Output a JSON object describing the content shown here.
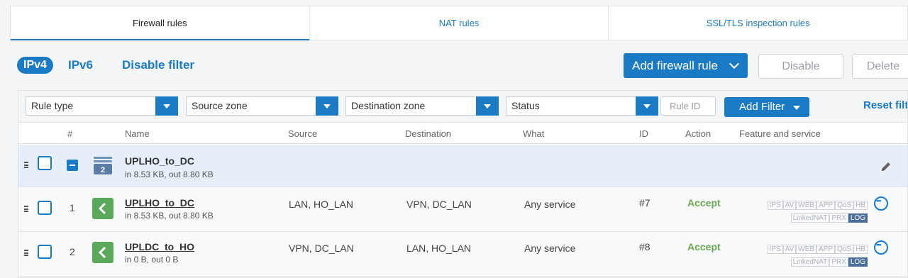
{
  "tabs": [
    {
      "label": "Firewall rules",
      "active": true
    },
    {
      "label": "NAT rules",
      "active": false
    },
    {
      "label": "SSL/TLS inspection rules",
      "active": false
    }
  ],
  "toolbar": {
    "ipv4": "IPv4",
    "ipv6": "IPv6",
    "disable_filter": "Disable filter",
    "add_rule": "Add firewall rule",
    "disable": "Disable",
    "delete": "Delete"
  },
  "filters": {
    "rule_type": "Rule type",
    "source_zone": "Source zone",
    "destination_zone": "Destination zone",
    "status": "Status",
    "rule_id_placeholder": "Rule ID",
    "add_filter": "Add Filter",
    "reset": "Reset filt"
  },
  "columns": {
    "num": "#",
    "name": "Name",
    "source": "Source",
    "destination": "Destination",
    "what": "What",
    "id": "ID",
    "action": "Action",
    "feature": "Feature and service"
  },
  "group": {
    "name": "UPLHO_to_DC",
    "traffic": "in 8.53 KB, out 8.80 KB",
    "count": "2"
  },
  "rules": [
    {
      "num": "1",
      "name": "UPLHO_to_DC",
      "traffic": "in 8.53 KB, out 8.80 KB",
      "source": "LAN, HO_LAN",
      "destination": "VPN, DC_LAN",
      "what": "Any service",
      "id": "#7",
      "action": "Accept"
    },
    {
      "num": "2",
      "name": "UPLDC_to_HO",
      "traffic": "in 0 B, out 0 B",
      "source": "VPN, DC_LAN",
      "destination": "LAN, HO_LAN",
      "what": "Any service",
      "id": "#8",
      "action": "Accept"
    }
  ],
  "feature_tags": {
    "line1": [
      "IPS",
      "AV",
      "WEB",
      "APP",
      "QoS",
      "HB"
    ],
    "line2": [
      "LinkedNAT",
      "PRX",
      "LOG"
    ]
  },
  "colors": {
    "accent": "#1a7ac4",
    "accept": "#6aa84f",
    "rule_icon": "#5aa85a",
    "log_tag": "#4b6f9a"
  }
}
